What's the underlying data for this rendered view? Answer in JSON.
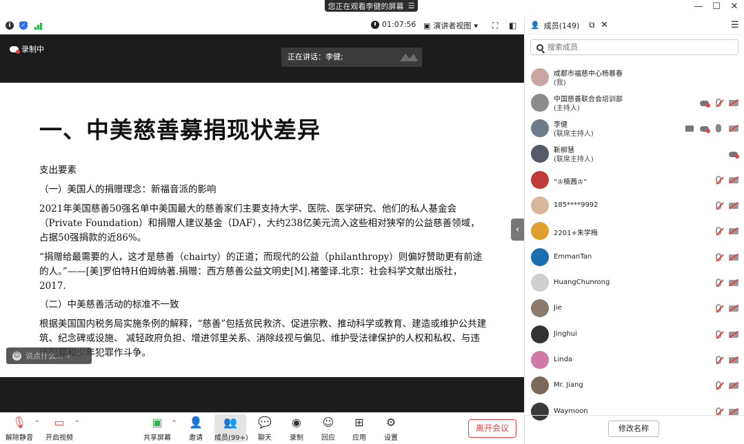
{
  "window": {
    "share_banner": "您正在观看李健的屏幕"
  },
  "topbar": {
    "timer": "01:07:56",
    "view_mode": "演讲者视图"
  },
  "stage": {
    "recording": "录制中",
    "speaking": "正在讲话：李健;",
    "chat_placeholder": "说点什么..."
  },
  "slide": {
    "title": "一、中美慈善募捐现状差异",
    "p1": "支出要素",
    "p2": "（一）美国人的捐赠理念：新福音派的影响",
    "p3": "2021年美国慈善50强名单中美国最大的慈善家们主要支持大学、医院、医学研究、他们的私人基金会（Private Foundation）和捐赠人建议基金（DAF），大约238亿美元流入这些相对狭窄的公益慈善领域，占据50强捐款的近86%。",
    "p4": "“捐赠给最需要的人，这才是慈善（chairty）的正道；而现代的公益（philanthropy）则偏好赞助更有前途的人。”——[美]罗伯特H伯姆纳著.捐赠：西方慈善公益文明史[M].褚蓥译.北京：社会科学文献出版社，2017.",
    "p5": "（二）中美慈善活动的标准不一致",
    "p6": "根据美国国内税务局实施条例的解释，“慈善”包括贫民救济、促进宗教、推动科学或教育、建造或维护公共建筑、纪念碑或设施、 减轻政府负担、增进邻里关系、消除歧视与偏见、维护受法律保护的人权和私权、与违法犯罪和少年犯罪作斗争。"
  },
  "bottombar": {
    "tools": [
      {
        "id": "unmute",
        "label": "解除静音"
      },
      {
        "id": "start-video",
        "label": "开启视频"
      },
      {
        "id": "share-screen",
        "label": "共享屏幕"
      },
      {
        "id": "invite",
        "label": "邀请"
      },
      {
        "id": "members",
        "label": "成员(99+)"
      },
      {
        "id": "chat",
        "label": "聊天"
      },
      {
        "id": "record",
        "label": "录制"
      },
      {
        "id": "reactions",
        "label": "回应"
      },
      {
        "id": "apps",
        "label": "应用"
      },
      {
        "id": "settings",
        "label": "设置"
      }
    ],
    "leave": "离开会议"
  },
  "panel": {
    "title": "成员(149)",
    "search_placeholder": "搜索成员",
    "rename": "修改名称",
    "members": [
      {
        "name": "成都市福慈中心杨慕春",
        "role": "(我)",
        "color": "#c9a7a0"
      },
      {
        "name": "中国慈善联合会培训部",
        "role": "(主持人)",
        "color": "#8b8b8b"
      },
      {
        "name": "李健",
        "role": "(联席主持人)",
        "color": "#6e7b8b"
      },
      {
        "name": "靳柳慧",
        "role": "(联席主持人)",
        "color": "#555b66"
      },
      {
        "name": "“♔楠茜♔”",
        "role": "",
        "color": "#c23b3b"
      },
      {
        "name": "185****9992",
        "role": "",
        "color": "#d8b89a"
      },
      {
        "name": "2201+朱学梅",
        "role": "",
        "color": "#e0a030"
      },
      {
        "name": "EmmanTan",
        "role": "",
        "color": "#1a6fb0"
      },
      {
        "name": "HuangChunrong",
        "role": "",
        "color": "#cfcfcf"
      },
      {
        "name": "Jie",
        "role": "",
        "color": "#8a7b6a"
      },
      {
        "name": "Jinghui",
        "role": "",
        "color": "#333333"
      },
      {
        "name": "Linda",
        "role": "",
        "color": "#d07aa8"
      },
      {
        "name": "Mr. Jiang",
        "role": "",
        "color": "#7b6a5a"
      },
      {
        "name": "Waymoon",
        "role": "",
        "color": "#3a3a3a"
      }
    ]
  }
}
